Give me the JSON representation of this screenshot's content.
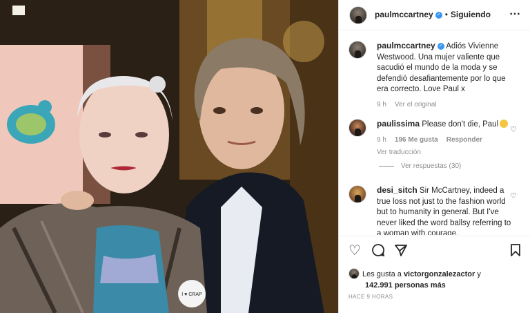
{
  "post": {
    "author": "paulmccartney",
    "follow_status": "Siguiendo",
    "separator": "•",
    "more_icon": "⋯",
    "verified_mark": "✓"
  },
  "caption": {
    "user": "paulmccartney",
    "text": "Adiós Vivienne Westwood. Una mujer valiente que sacudió el mundo de la moda y se defendió desafiantemente por lo que era correcto. Love Paul x",
    "time": "9 h",
    "link": "Ver el original"
  },
  "comments": [
    {
      "user": "paulissima",
      "text": "Please don't die, Paul",
      "time": "9 h",
      "likes": "196 Me gusta",
      "reply": "Responder",
      "translate": "Ver traducción",
      "replies": "Ver respuestas (30)"
    },
    {
      "user": "desi_sitch",
      "text": "Sir McCartney, indeed a true loss not just to the fashion world but to humanity in general. But I've never liked the word ballsy referring to a woman with courage."
    }
  ],
  "actions": {
    "like_icon": "heart-icon",
    "comment_icon": "comment-icon",
    "share_icon": "share-icon",
    "save_icon": "bookmark-icon"
  },
  "likes": {
    "prefix": "Les gusta a",
    "user": "victorgonzalezactor",
    "conj": "y",
    "count": "142.991 personas más"
  },
  "timestamp": "HACE 9 HORAS",
  "photo": {
    "badge_text": "I ♥ CRAP"
  }
}
